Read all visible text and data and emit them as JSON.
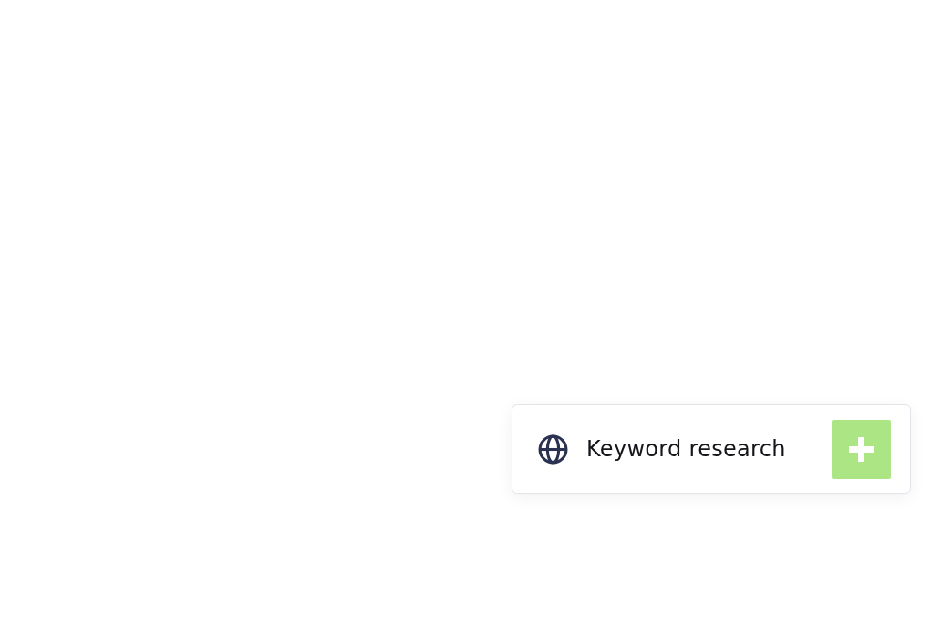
{
  "card": {
    "label": "Keyword research"
  }
}
